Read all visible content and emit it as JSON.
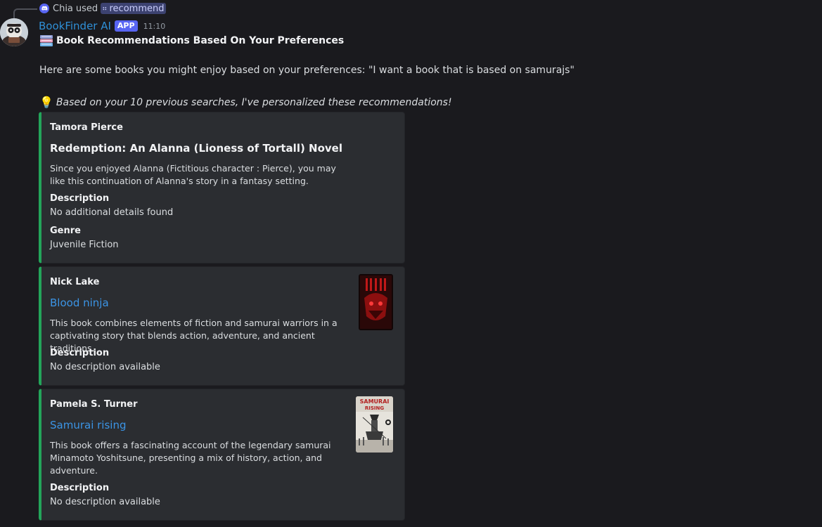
{
  "reply": {
    "user": "Chia",
    "used_text": "used",
    "command": "recommend"
  },
  "message": {
    "bot_name": "BookFinder AI",
    "app_badge": "APP",
    "time": "11:10",
    "title": "Book Recommendations Based On Your Preferences",
    "intro": "Here are some books you might enjoy based on your preferences: \"I want a book that is based on samurajs\"",
    "tip_emoji": "💡",
    "tip": "Based on your 10 previous searches, I've personalized these recommendations!"
  },
  "embeds": [
    {
      "author": "Tamora Pierce",
      "title": "Redemption: An Alanna (Lioness of Tortall) Novel",
      "summary": "Since you enjoyed Alanna (Fictitious character : Pierce), you may like this continuation of Alanna's story in a fantasy setting.",
      "fields": [
        {
          "name": "Description",
          "value": "No additional details found"
        },
        {
          "name": "Genre",
          "value": "Juvenile Fiction"
        }
      ]
    },
    {
      "author": "Nick Lake",
      "title": "Blood ninja",
      "summary": "This book combines elements of fiction and samurai warriors in a captivating story that blends action, adventure, and ancient traditions.",
      "fields": [
        {
          "name": "Description",
          "value": "No description available"
        }
      ]
    },
    {
      "author": "Pamela S. Turner",
      "title": "Samurai rising",
      "summary": "This book offers a fascinating account of the legendary samurai Minamoto Yoshitsune, presenting a mix of history, action, and adventure.",
      "fields": [
        {
          "name": "Description",
          "value": "No description available"
        }
      ],
      "cover_text": "SAMURAI RISING"
    }
  ],
  "colors": {
    "background": "#1a1a1e",
    "embed_bg": "#2b2d31",
    "embed_accent": "#23a55a",
    "bot_name": "#2f8fd6",
    "link": "#3b94e5",
    "app_badge": "#5865f2"
  },
  "icons": {
    "reply_app_icon": "discord-icon",
    "command_icon": "slash-command-icon",
    "title_emoji": "books-icon",
    "avatar": "bot-avatar-icon"
  }
}
